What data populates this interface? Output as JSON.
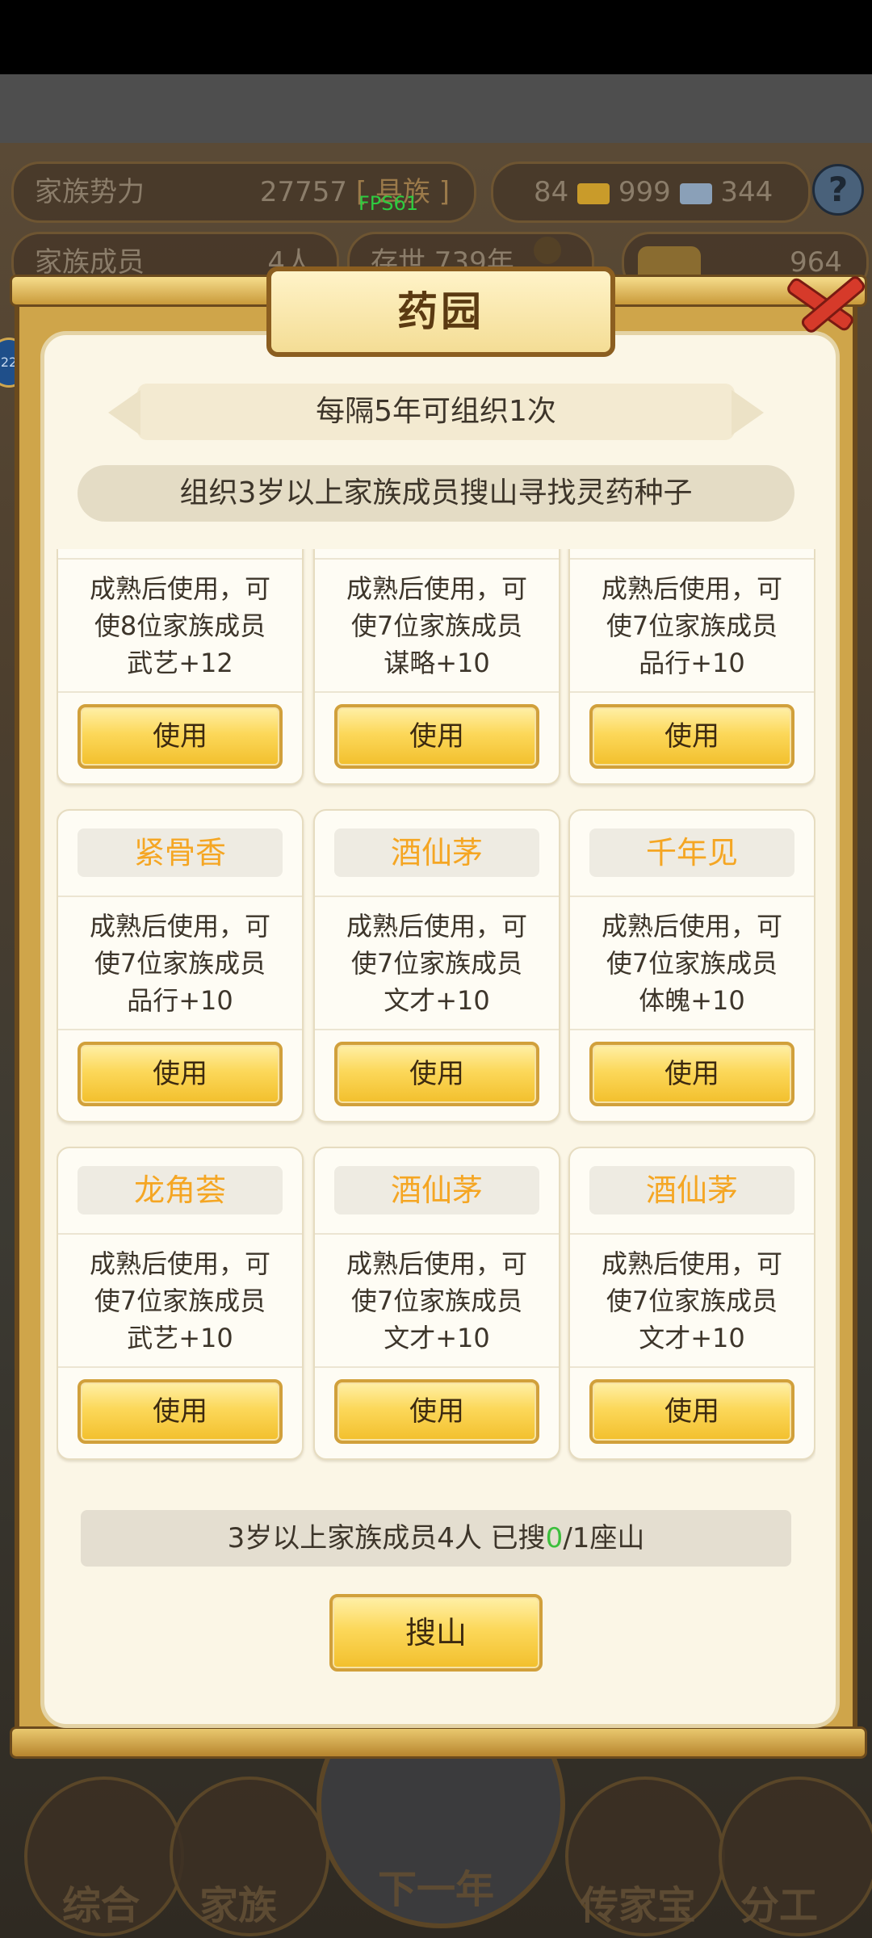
{
  "hud": {
    "family_power_label": "家族势力",
    "family_power_value": "27757",
    "family_power_rank": "[ 县族 ]",
    "gold": "84",
    "silver": "999",
    "coins": "344",
    "help": "?",
    "members_label": "家族成员",
    "members_value": "4人",
    "era": "存世 739年",
    "ingots": "964",
    "fps": "FPS61",
    "left_badge": "22"
  },
  "dialog": {
    "title": "药园",
    "frequency": "每隔5年可组织1次",
    "description": "组织3岁以上家族成员搜山寻找灵药种子",
    "status_prefix": "3岁以上家族成员4人 已搜",
    "status_searched": "0",
    "status_suffix": "/1座山",
    "search_button": "搜山"
  },
  "cards": [
    {
      "name": "",
      "effect_lines": [
        "成熟后使用，可",
        "使8位家族成员",
        "武艺+12"
      ],
      "button": "使用"
    },
    {
      "name": "",
      "effect_lines": [
        "成熟后使用，可",
        "使7位家族成员",
        "谋略+10"
      ],
      "button": "使用"
    },
    {
      "name": "",
      "effect_lines": [
        "成熟后使用，可",
        "使7位家族成员",
        "品行+10"
      ],
      "button": "使用"
    },
    {
      "name": "紧骨香",
      "effect_lines": [
        "成熟后使用，可",
        "使7位家族成员",
        "品行+10"
      ],
      "button": "使用"
    },
    {
      "name": "酒仙茅",
      "effect_lines": [
        "成熟后使用，可",
        "使7位家族成员",
        "文才+10"
      ],
      "button": "使用"
    },
    {
      "name": "千年见",
      "effect_lines": [
        "成熟后使用，可",
        "使7位家族成员",
        "体魄+10"
      ],
      "button": "使用"
    },
    {
      "name": "龙角荟",
      "effect_lines": [
        "成熟后使用，可",
        "使7位家族成员",
        "武艺+10"
      ],
      "button": "使用"
    },
    {
      "name": "酒仙茅",
      "effect_lines": [
        "成熟后使用，可",
        "使7位家族成员",
        "文才+10"
      ],
      "button": "使用"
    },
    {
      "name": "酒仙茅",
      "effect_lines": [
        "成熟后使用，可",
        "使7位家族成员",
        "文才+10"
      ],
      "button": "使用"
    }
  ],
  "nav": [
    {
      "label": "综合",
      "icon": "scroll-icon"
    },
    {
      "label": "家族",
      "icon": "temple-icon"
    },
    {
      "label": "下一年",
      "icon": "mountain-icon"
    },
    {
      "label": "传家宝",
      "icon": "treasure-icon"
    },
    {
      "label": "分工",
      "icon": "people-icon"
    }
  ]
}
